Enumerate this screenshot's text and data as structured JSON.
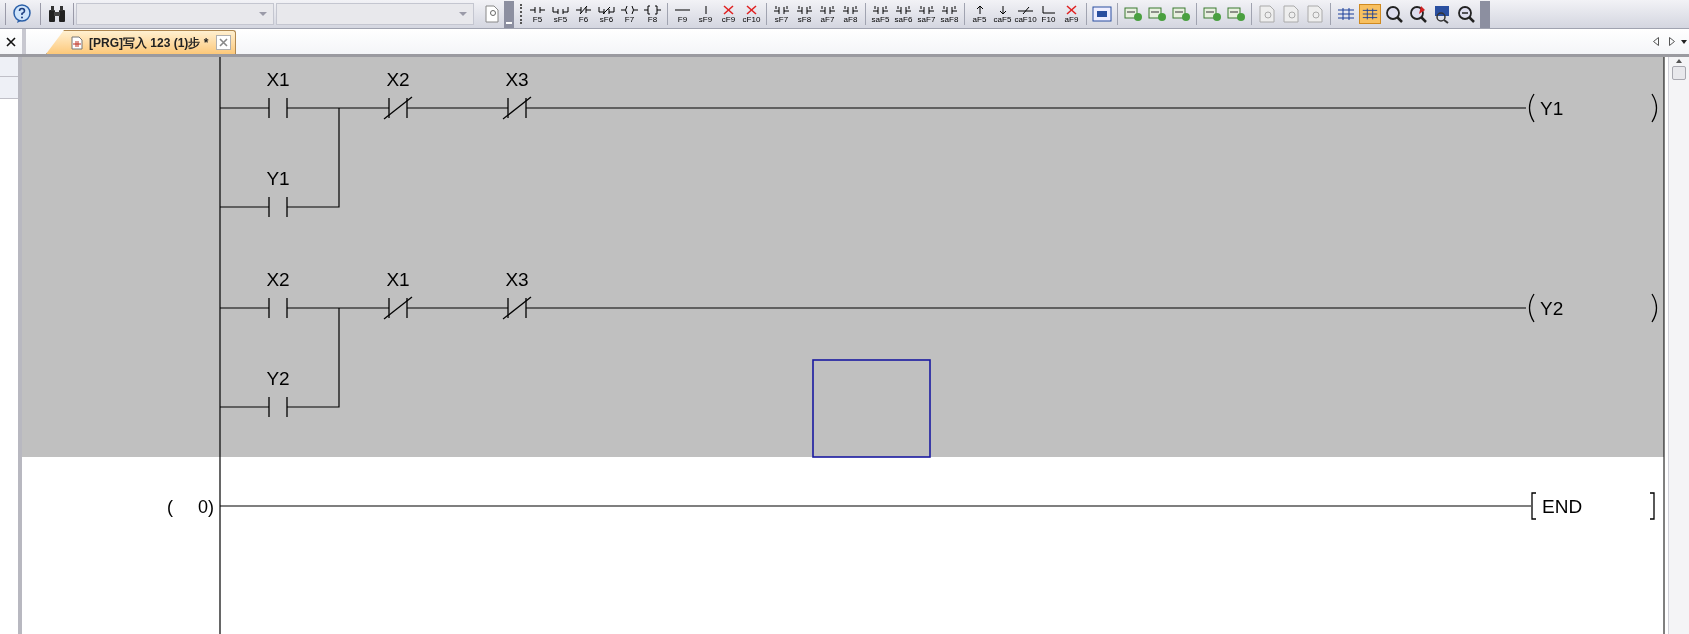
{
  "toolbar": {
    "function_keys": [
      {
        "label": "F5",
        "kind": "no"
      },
      {
        "label": "sF5",
        "kind": "or-no"
      },
      {
        "label": "F6",
        "kind": "nc"
      },
      {
        "label": "sF6",
        "kind": "or-nc"
      },
      {
        "label": "F7",
        "kind": "coil"
      },
      {
        "label": "F8",
        "kind": "func"
      },
      {
        "label": "F9",
        "kind": "hline"
      },
      {
        "label": "sF9",
        "kind": "vline"
      },
      {
        "label": "cF9",
        "kind": "del"
      },
      {
        "label": "cF10",
        "kind": "del"
      },
      {
        "label": "sF7",
        "kind": "pulse"
      },
      {
        "label": "sF8",
        "kind": "pulse"
      },
      {
        "label": "aF7",
        "kind": "pulse"
      },
      {
        "label": "aF8",
        "kind": "pulse"
      },
      {
        "label": "saF5",
        "kind": "pulse"
      },
      {
        "label": "saF6",
        "kind": "pulse"
      },
      {
        "label": "saF7",
        "kind": "pulse"
      },
      {
        "label": "saF8",
        "kind": "pulse"
      },
      {
        "label": "aF5",
        "kind": "up"
      },
      {
        "label": "caF5",
        "kind": "down"
      },
      {
        "label": "caF10",
        "kind": "invert"
      },
      {
        "label": "F10",
        "kind": "line"
      },
      {
        "label": "aF9",
        "kind": "del"
      }
    ]
  },
  "tab": {
    "label": "[PRG]写入 123 (1)步 *",
    "selected": true
  },
  "rungs": [
    {
      "selected": true,
      "contacts": [
        {
          "label": "X1",
          "kind": "no"
        },
        {
          "label": "X2",
          "kind": "nc"
        },
        {
          "label": "X3",
          "kind": "nc"
        }
      ],
      "branch": {
        "label": "Y1",
        "kind": "no"
      },
      "coil": "Y1"
    },
    {
      "selected": true,
      "contacts": [
        {
          "label": "X2",
          "kind": "no"
        },
        {
          "label": "X1",
          "kind": "nc"
        },
        {
          "label": "X3",
          "kind": "nc"
        }
      ],
      "branch": {
        "label": "Y2",
        "kind": "no"
      },
      "coil": "Y2"
    }
  ],
  "end_row": {
    "step": "(     0)",
    "instruction": "END"
  }
}
